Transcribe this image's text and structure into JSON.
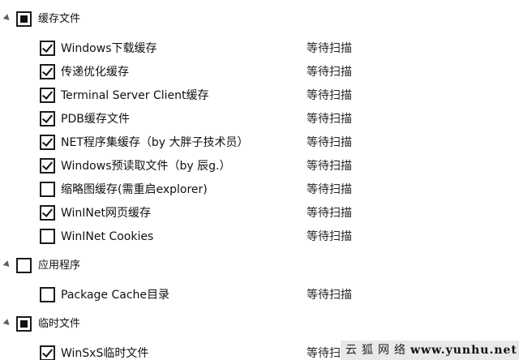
{
  "status_text": "等待扫描",
  "groups": [
    {
      "label": "缓存文件",
      "state": "partial",
      "items": [
        {
          "label": "Windows下载缓存",
          "checked": true
        },
        {
          "label": "传递优化缓存",
          "checked": true
        },
        {
          "label": "Terminal Server Client缓存",
          "checked": true
        },
        {
          "label": "PDB缓存文件",
          "checked": true
        },
        {
          "label": "NET程序集缓存（by 大胖子技术员）",
          "checked": true
        },
        {
          "label": "Windows预读取文件（by 辰g.）",
          "checked": true
        },
        {
          "label": "缩略图缓存(需重启explorer)",
          "checked": false
        },
        {
          "label": "WinINet网页缓存",
          "checked": true
        },
        {
          "label": "WinINet Cookies",
          "checked": false
        }
      ]
    },
    {
      "label": "应用程序",
      "state": "unchecked",
      "items": [
        {
          "label": "Package Cache目录",
          "checked": false
        }
      ]
    },
    {
      "label": "临时文件",
      "state": "partial",
      "items": [
        {
          "label": "WinSxS临时文件",
          "checked": true
        }
      ]
    }
  ],
  "watermark": {
    "cn": "云狐网络",
    "url": "www.yunhu.net"
  }
}
